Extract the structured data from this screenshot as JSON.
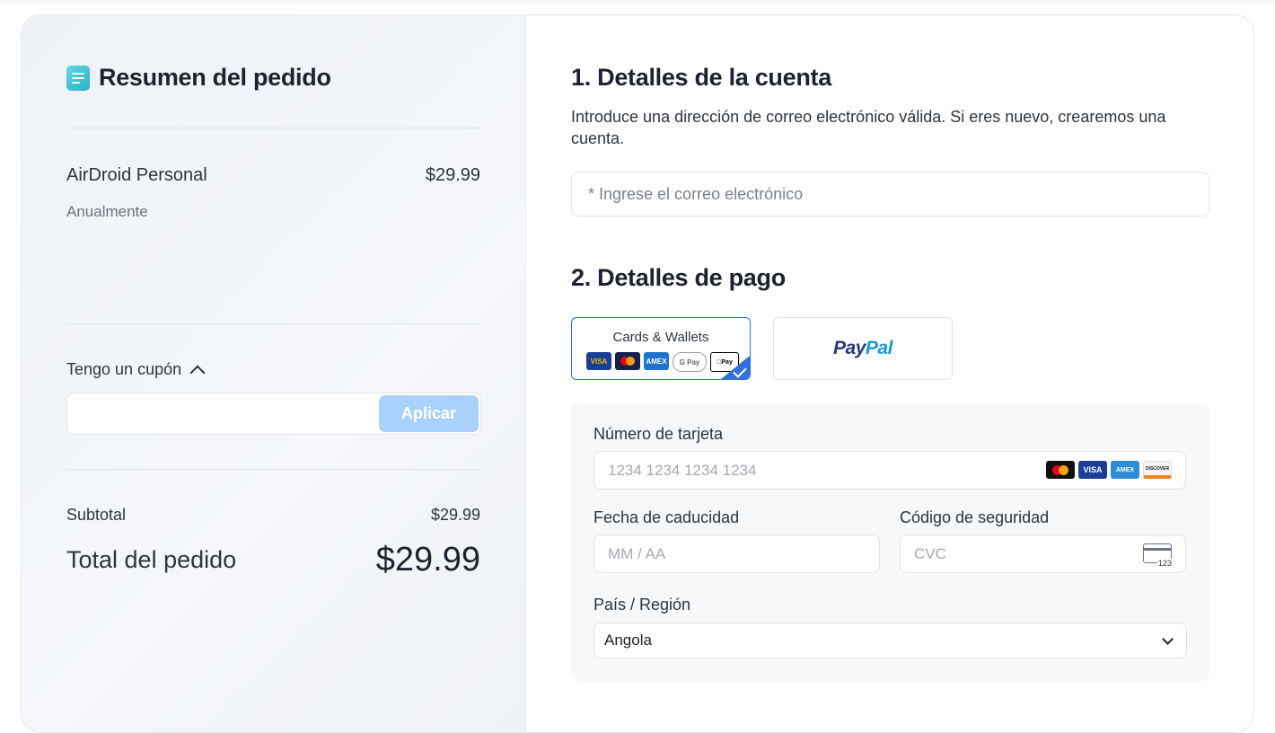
{
  "summary": {
    "title": "Resumen del pedido",
    "item": {
      "name": "AirDroid Personal",
      "price": "$29.99",
      "period": "Anualmente"
    },
    "coupon": {
      "toggle_label": "Tengo un cupón",
      "input_value": "",
      "apply_label": "Aplicar"
    },
    "subtotal": {
      "label": "Subtotal",
      "value": "$29.99"
    },
    "total": {
      "label": "Total del pedido",
      "value": "$29.99"
    }
  },
  "account": {
    "heading": "1. Detalles de la cuenta",
    "description": "Introduce una dirección de correo electrónico válida. Si eres nuevo, crearemos una cuenta.",
    "email_placeholder": "* Ingrese el correo electrónico"
  },
  "payment": {
    "heading": "2. Detalles de pago",
    "methods": {
      "cards_label": "Cards & Wallets",
      "card_logos": [
        "VISA",
        "MasterCard",
        "AMEX",
        "G Pay",
        "Apple Pay"
      ],
      "paypal_pay": "Pay",
      "paypal_pal": "Pal"
    },
    "card_number": {
      "label": "Número de tarjeta",
      "placeholder": "1234 1234 1234 1234",
      "brands": [
        "MasterCard",
        "VISA",
        "AMEX",
        "DISCOVER"
      ]
    },
    "expiry": {
      "label": "Fecha de caducidad",
      "placeholder": "MM / AA"
    },
    "cvc": {
      "label": "Código de seguridad",
      "placeholder": "CVC",
      "icon_text": "123"
    },
    "country": {
      "label": "País / Región",
      "selected": "Angola"
    }
  },
  "colors": {
    "accent": "#2f6fde",
    "apply_button": "#a9d1fb",
    "summary_bg": "#eef2f6"
  }
}
